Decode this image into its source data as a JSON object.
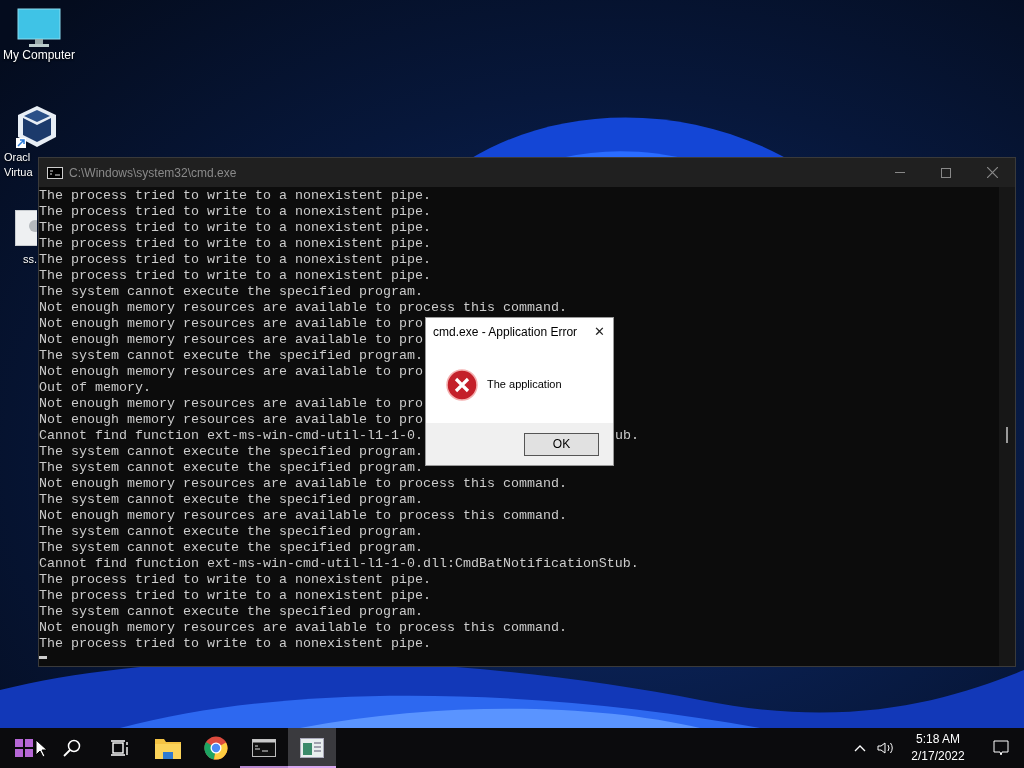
{
  "desktop_icons": [
    {
      "kind": "computer",
      "lines": [
        "My Computer"
      ]
    },
    {
      "kind": "virtualbox",
      "lines": [
        "Oracl",
        "Virtua"
      ]
    },
    {
      "kind": "file",
      "lines": [
        "ss."
      ]
    }
  ],
  "console": {
    "title": "C:\\Windows\\system32\\cmd.exe",
    "lines": [
      {
        "text": "The process tried to write to a nonexistent pipe."
      },
      {
        "text": "The process tried to write to a nonexistent pipe."
      },
      {
        "text": "The process tried to write to a nonexistent pipe."
      },
      {
        "text": "The process tried to write to a nonexistent pipe."
      },
      {
        "text": "The process tried to write to a nonexistent pipe."
      },
      {
        "text": "The process tried to write to a nonexistent pipe."
      },
      {
        "text": "The system cannot execute the specified program."
      },
      {
        "text": "Not enough memory resources are available to process this command."
      },
      {
        "text": "Not enough memory resources are available to pro"
      },
      {
        "text": "Not enough memory resources are available to pro"
      },
      {
        "text": "The system cannot execute the specified program."
      },
      {
        "text": "Not enough memory resources are available to pro"
      },
      {
        "text": "Out of memory."
      },
      {
        "text": "Not enough memory resources are available to pro"
      },
      {
        "text": "Not enough memory resources are available to pro"
      },
      {
        "text": "Cannot find function ext-ms-win-cmd-util-l1-1-0.",
        "tail": "ub."
      },
      {
        "text": "The system cannot execute the specified program."
      },
      {
        "text": "The system cannot execute the specified program."
      },
      {
        "text": "Not enough memory resources are available to process this command."
      },
      {
        "text": "The system cannot execute the specified program."
      },
      {
        "text": "Not enough memory resources are available to process this command."
      },
      {
        "text": "The system cannot execute the specified program."
      },
      {
        "text": "The system cannot execute the specified program."
      },
      {
        "text": "Cannot find function ext-ms-win-cmd-util-l1-1-0.dll:CmdBatNotificationStub."
      },
      {
        "text": "The process tried to write to a nonexistent pipe."
      },
      {
        "text": "The process tried to write to a nonexistent pipe."
      },
      {
        "text": "The system cannot execute the specified program."
      },
      {
        "text": "Not enough memory resources are available to process this command."
      },
      {
        "text": "The process tried to write to a nonexistent pipe."
      }
    ]
  },
  "dialog": {
    "title": "cmd.exe - Application Error",
    "close": "✕",
    "message": "The application",
    "button": "OK"
  },
  "taskbar": {
    "items": [
      {
        "kind": "start",
        "selected": false,
        "running": false
      },
      {
        "kind": "search",
        "selected": false,
        "running": false
      },
      {
        "kind": "taskview",
        "selected": false,
        "running": false
      },
      {
        "kind": "explorer",
        "selected": false,
        "running": false
      },
      {
        "kind": "chrome",
        "selected": false,
        "running": false
      },
      {
        "kind": "terminal",
        "selected": false,
        "running": true
      },
      {
        "kind": "app",
        "selected": true,
        "running": true
      }
    ],
    "time": "5:18 AM",
    "date": "2/17/2022"
  }
}
